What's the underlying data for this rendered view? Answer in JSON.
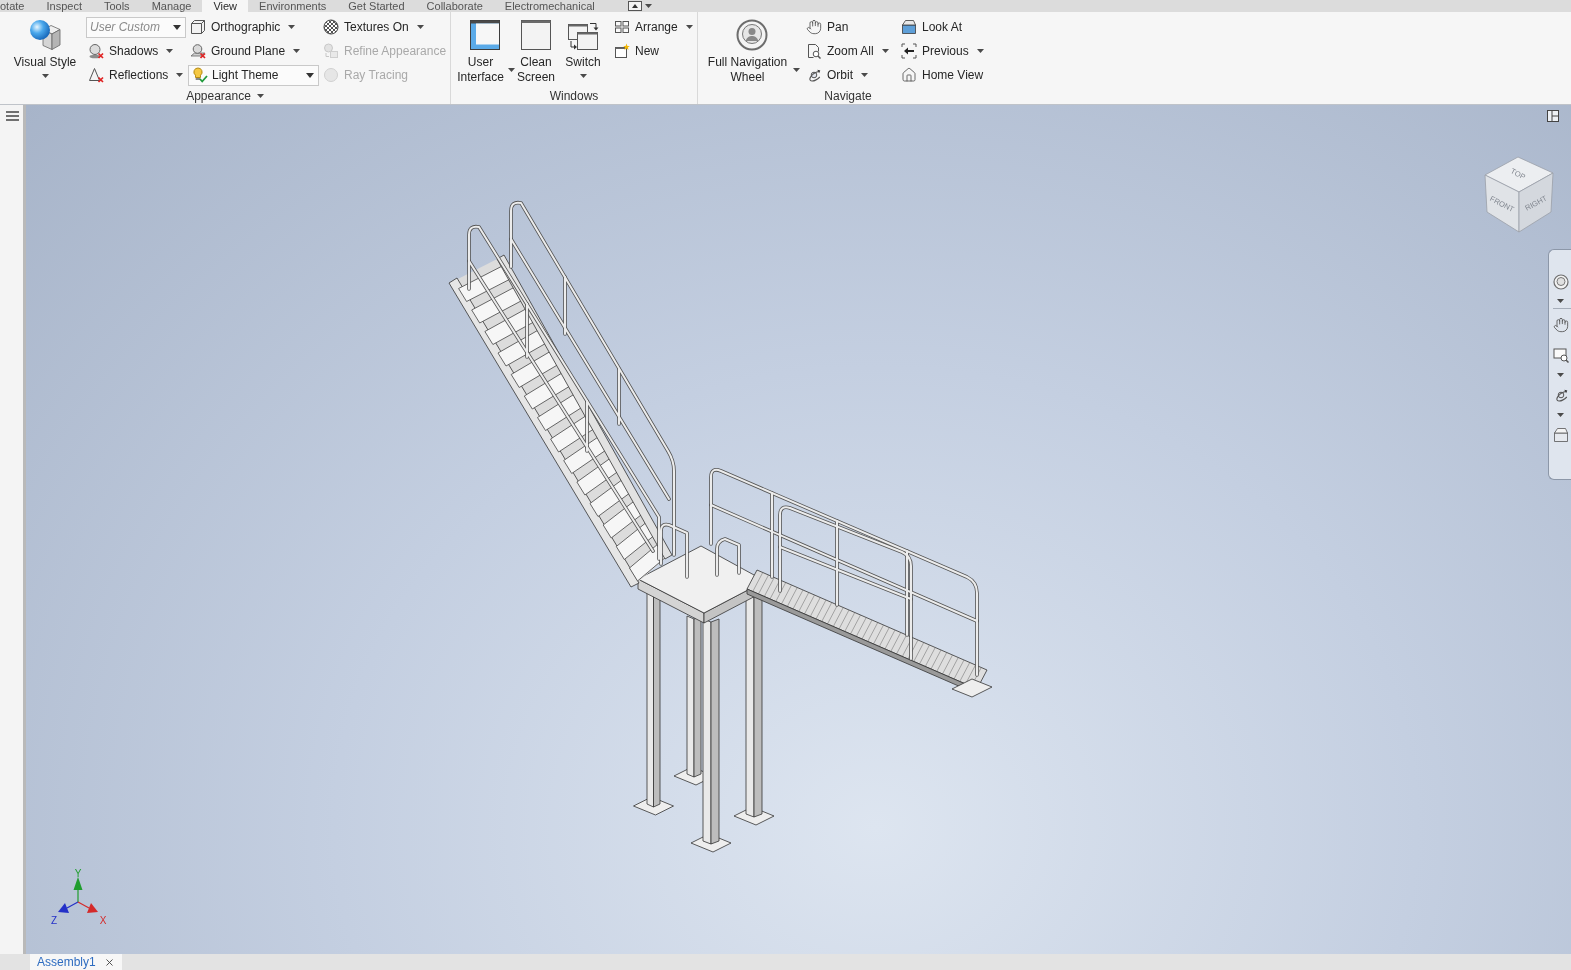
{
  "tabs": [
    {
      "label": "otate",
      "selected": false
    },
    {
      "label": "Inspect",
      "selected": false
    },
    {
      "label": "Tools",
      "selected": false
    },
    {
      "label": "Manage",
      "selected": false
    },
    {
      "label": "View",
      "selected": true
    },
    {
      "label": "Environments",
      "selected": false
    },
    {
      "label": "Get Started",
      "selected": false
    },
    {
      "label": "Collaborate",
      "selected": false
    },
    {
      "label": "Electromechanical",
      "selected": false
    }
  ],
  "ribbon": {
    "panels": [
      {
        "title": "Appearance",
        "dropdown": true,
        "columns": [
          [
            {
              "kind": "large",
              "label": "Visual Style",
              "dropdown": true
            }
          ],
          [
            {
              "kind": "combo",
              "placeholder": "User Custom"
            },
            {
              "kind": "small",
              "label": "Shadows",
              "dropdown": true,
              "disabled": false
            },
            {
              "kind": "small",
              "label": "Reflections",
              "dropdown": true,
              "disabled": false
            }
          ],
          [
            {
              "kind": "small",
              "label": "Orthographic",
              "dropdown": true,
              "disabled": false
            },
            {
              "kind": "small",
              "label": "Ground Plane",
              "dropdown": true,
              "disabled": false
            },
            {
              "kind": "combo",
              "value": "Light Theme"
            }
          ],
          [
            {
              "kind": "small",
              "label": "Textures On",
              "dropdown": true,
              "disabled": false
            },
            {
              "kind": "small",
              "label": "Refine Appearance",
              "dropdown": false,
              "disabled": true
            },
            {
              "kind": "small",
              "label": "Ray Tracing",
              "dropdown": false,
              "disabled": true
            }
          ]
        ]
      },
      {
        "title": "Windows",
        "dropdown": false,
        "columns": [
          [
            {
              "kind": "large",
              "label": "User Interface",
              "dropdown": true
            }
          ],
          [
            {
              "kind": "large",
              "label": "Clean Screen",
              "dropdown": false
            }
          ],
          [
            {
              "kind": "large",
              "label": "Switch",
              "dropdown": true
            }
          ],
          [
            {
              "kind": "small",
              "label": "Arrange",
              "dropdown": true,
              "disabled": false
            },
            {
              "kind": "small",
              "label": "New",
              "dropdown": false,
              "disabled": false
            }
          ]
        ]
      },
      {
        "title": "Navigate",
        "dropdown": false,
        "columns": [
          [
            {
              "kind": "large",
              "label": "Full Navigation Wheel",
              "dropdown": true
            }
          ],
          [
            {
              "kind": "small",
              "label": "Pan",
              "dropdown": false,
              "disabled": false
            },
            {
              "kind": "small",
              "label": "Zoom All",
              "dropdown": true,
              "disabled": false
            },
            {
              "kind": "small",
              "label": "Orbit",
              "dropdown": true,
              "disabled": false
            }
          ],
          [
            {
              "kind": "small",
              "label": "Look At",
              "dropdown": false,
              "disabled": false
            },
            {
              "kind": "small",
              "label": "Previous",
              "dropdown": true,
              "disabled": false
            },
            {
              "kind": "small",
              "label": "Home View",
              "dropdown": false,
              "disabled": false
            }
          ]
        ]
      }
    ]
  },
  "viewport": {
    "view_cube": {
      "faces": [
        "TOP",
        "FRONT",
        "RIGHT"
      ]
    },
    "axes": [
      {
        "label": "Y",
        "color": "#1f9d2e"
      },
      {
        "label": "Z",
        "color": "#2330c8"
      },
      {
        "label": "X",
        "color": "#d42a2a"
      }
    ]
  },
  "document_tabs": [
    {
      "label": "Assembly1",
      "selected": true
    }
  ]
}
